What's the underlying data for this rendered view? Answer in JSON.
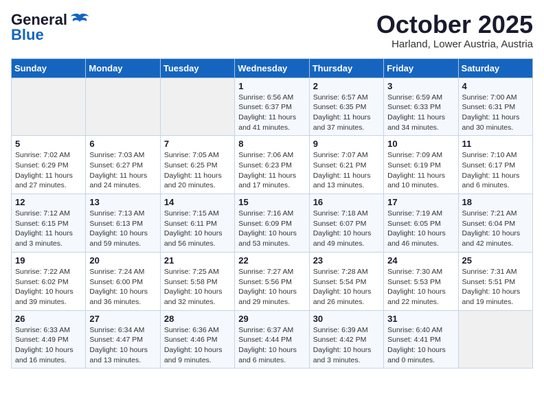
{
  "header": {
    "logo_general": "General",
    "logo_blue": "Blue",
    "month": "October 2025",
    "location": "Harland, Lower Austria, Austria"
  },
  "weekdays": [
    "Sunday",
    "Monday",
    "Tuesday",
    "Wednesday",
    "Thursday",
    "Friday",
    "Saturday"
  ],
  "weeks": [
    [
      {
        "day": "",
        "info": ""
      },
      {
        "day": "",
        "info": ""
      },
      {
        "day": "",
        "info": ""
      },
      {
        "day": "1",
        "info": "Sunrise: 6:56 AM\nSunset: 6:37 PM\nDaylight: 11 hours\nand 41 minutes."
      },
      {
        "day": "2",
        "info": "Sunrise: 6:57 AM\nSunset: 6:35 PM\nDaylight: 11 hours\nand 37 minutes."
      },
      {
        "day": "3",
        "info": "Sunrise: 6:59 AM\nSunset: 6:33 PM\nDaylight: 11 hours\nand 34 minutes."
      },
      {
        "day": "4",
        "info": "Sunrise: 7:00 AM\nSunset: 6:31 PM\nDaylight: 11 hours\nand 30 minutes."
      }
    ],
    [
      {
        "day": "5",
        "info": "Sunrise: 7:02 AM\nSunset: 6:29 PM\nDaylight: 11 hours\nand 27 minutes."
      },
      {
        "day": "6",
        "info": "Sunrise: 7:03 AM\nSunset: 6:27 PM\nDaylight: 11 hours\nand 24 minutes."
      },
      {
        "day": "7",
        "info": "Sunrise: 7:05 AM\nSunset: 6:25 PM\nDaylight: 11 hours\nand 20 minutes."
      },
      {
        "day": "8",
        "info": "Sunrise: 7:06 AM\nSunset: 6:23 PM\nDaylight: 11 hours\nand 17 minutes."
      },
      {
        "day": "9",
        "info": "Sunrise: 7:07 AM\nSunset: 6:21 PM\nDaylight: 11 hours\nand 13 minutes."
      },
      {
        "day": "10",
        "info": "Sunrise: 7:09 AM\nSunset: 6:19 PM\nDaylight: 11 hours\nand 10 minutes."
      },
      {
        "day": "11",
        "info": "Sunrise: 7:10 AM\nSunset: 6:17 PM\nDaylight: 11 hours\nand 6 minutes."
      }
    ],
    [
      {
        "day": "12",
        "info": "Sunrise: 7:12 AM\nSunset: 6:15 PM\nDaylight: 11 hours\nand 3 minutes."
      },
      {
        "day": "13",
        "info": "Sunrise: 7:13 AM\nSunset: 6:13 PM\nDaylight: 10 hours\nand 59 minutes."
      },
      {
        "day": "14",
        "info": "Sunrise: 7:15 AM\nSunset: 6:11 PM\nDaylight: 10 hours\nand 56 minutes."
      },
      {
        "day": "15",
        "info": "Sunrise: 7:16 AM\nSunset: 6:09 PM\nDaylight: 10 hours\nand 53 minutes."
      },
      {
        "day": "16",
        "info": "Sunrise: 7:18 AM\nSunset: 6:07 PM\nDaylight: 10 hours\nand 49 minutes."
      },
      {
        "day": "17",
        "info": "Sunrise: 7:19 AM\nSunset: 6:05 PM\nDaylight: 10 hours\nand 46 minutes."
      },
      {
        "day": "18",
        "info": "Sunrise: 7:21 AM\nSunset: 6:04 PM\nDaylight: 10 hours\nand 42 minutes."
      }
    ],
    [
      {
        "day": "19",
        "info": "Sunrise: 7:22 AM\nSunset: 6:02 PM\nDaylight: 10 hours\nand 39 minutes."
      },
      {
        "day": "20",
        "info": "Sunrise: 7:24 AM\nSunset: 6:00 PM\nDaylight: 10 hours\nand 36 minutes."
      },
      {
        "day": "21",
        "info": "Sunrise: 7:25 AM\nSunset: 5:58 PM\nDaylight: 10 hours\nand 32 minutes."
      },
      {
        "day": "22",
        "info": "Sunrise: 7:27 AM\nSunset: 5:56 PM\nDaylight: 10 hours\nand 29 minutes."
      },
      {
        "day": "23",
        "info": "Sunrise: 7:28 AM\nSunset: 5:54 PM\nDaylight: 10 hours\nand 26 minutes."
      },
      {
        "day": "24",
        "info": "Sunrise: 7:30 AM\nSunset: 5:53 PM\nDaylight: 10 hours\nand 22 minutes."
      },
      {
        "day": "25",
        "info": "Sunrise: 7:31 AM\nSunset: 5:51 PM\nDaylight: 10 hours\nand 19 minutes."
      }
    ],
    [
      {
        "day": "26",
        "info": "Sunrise: 6:33 AM\nSunset: 4:49 PM\nDaylight: 10 hours\nand 16 minutes."
      },
      {
        "day": "27",
        "info": "Sunrise: 6:34 AM\nSunset: 4:47 PM\nDaylight: 10 hours\nand 13 minutes."
      },
      {
        "day": "28",
        "info": "Sunrise: 6:36 AM\nSunset: 4:46 PM\nDaylight: 10 hours\nand 9 minutes."
      },
      {
        "day": "29",
        "info": "Sunrise: 6:37 AM\nSunset: 4:44 PM\nDaylight: 10 hours\nand 6 minutes."
      },
      {
        "day": "30",
        "info": "Sunrise: 6:39 AM\nSunset: 4:42 PM\nDaylight: 10 hours\nand 3 minutes."
      },
      {
        "day": "31",
        "info": "Sunrise: 6:40 AM\nSunset: 4:41 PM\nDaylight: 10 hours\nand 0 minutes."
      },
      {
        "day": "",
        "info": ""
      }
    ]
  ]
}
